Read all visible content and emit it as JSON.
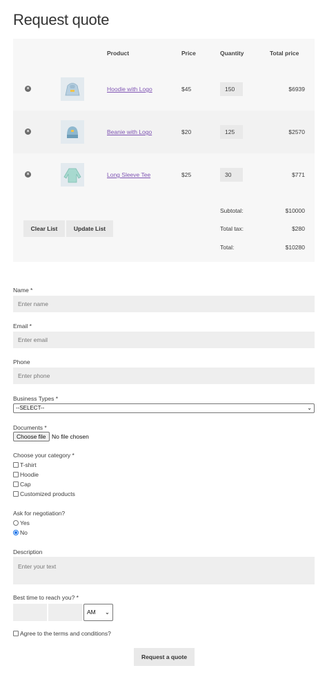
{
  "page_title": "Request quote",
  "table": {
    "headers": {
      "product": "Product",
      "price": "Price",
      "quantity": "Quantity",
      "total": "Total price"
    },
    "rows": [
      {
        "name": "Hoodie with Logo",
        "price": "$45",
        "qty": "150",
        "total": "$6939",
        "remove": "×",
        "icon": "hoodie-image"
      },
      {
        "name": "Beanie with Logo",
        "price": "$20",
        "qty": "125",
        "total": "$2570",
        "remove": "×",
        "icon": "beanie-image"
      },
      {
        "name": "Long Sleeve Tee",
        "price": "$25",
        "qty": "30",
        "total": "$771",
        "remove": "×",
        "icon": "long-sleeve-tee-image"
      }
    ],
    "clear_label": "Clear List",
    "update_label": "Update List",
    "subtotal_label": "Subtotal:",
    "subtotal": "$10000",
    "tax_label": "Total tax:",
    "tax": "$280",
    "total_label": "Total:",
    "total": "$10280"
  },
  "form": {
    "name_label": "Name *",
    "name_placeholder": "Enter name",
    "email_label": "Email *",
    "email_placeholder": "Enter email",
    "phone_label": "Phone",
    "phone_placeholder": "Enter phone",
    "business_label": "Business Types *",
    "business_selected": "--SELECT--",
    "documents_label": "Documents *",
    "choose_file": "Choose file",
    "no_file": "No file chosen",
    "category_label": "Choose your category *",
    "categories": [
      "T-shirt",
      "Hoodie",
      "Cap",
      "Customized products"
    ],
    "negotiation_label": "Ask for negotiation?",
    "negotiation_options": [
      "Yes",
      "No"
    ],
    "negotiation_selected": "No",
    "description_label": "Description",
    "description_placeholder": "Enter your text",
    "time_label": "Best time to reach you? *",
    "ampm_selected": "AM",
    "terms_label": "Agree to the terms and conditions?",
    "submit_label": "Request a quote"
  },
  "colors": {
    "link": "#7f54b3",
    "table_bg": "#f7f7f7",
    "field_bg": "#eeeeee",
    "radio_checked": "#1a73e8"
  }
}
